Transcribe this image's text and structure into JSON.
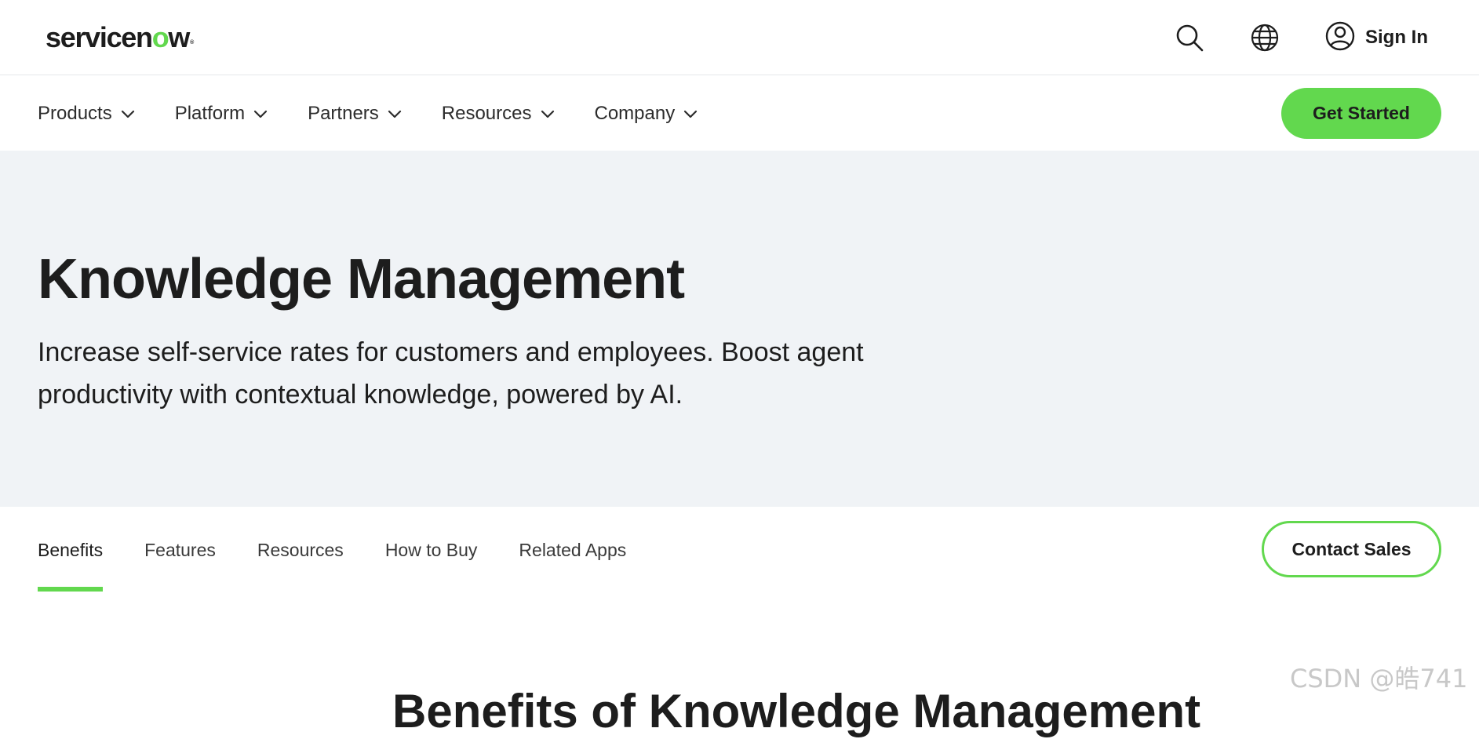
{
  "header": {
    "logo_text_before": "servicen",
    "logo_text_o": "o",
    "logo_text_after": "w",
    "logo_reg": "®",
    "icons": [
      "search-icon",
      "globe-icon",
      "user-circle-icon"
    ],
    "signin_label": "Sign In"
  },
  "nav": {
    "items": [
      {
        "label": "Products"
      },
      {
        "label": "Platform"
      },
      {
        "label": "Partners"
      },
      {
        "label": "Resources"
      },
      {
        "label": "Company"
      }
    ],
    "cta_label": "Get Started"
  },
  "hero": {
    "title": "Knowledge Management",
    "subtitle": "Increase self-service rates for customers and employees. Boost agent productivity with contextual knowledge, powered by AI."
  },
  "subnav": {
    "tabs": [
      {
        "label": "Benefits",
        "active": true
      },
      {
        "label": "Features",
        "active": false
      },
      {
        "label": "Resources",
        "active": false
      },
      {
        "label": "How to Buy",
        "active": false
      },
      {
        "label": "Related Apps",
        "active": false
      }
    ],
    "cta_label": "Contact Sales"
  },
  "section": {
    "heading": "Benefits of Knowledge Management"
  },
  "watermark": "CSDN @皓741",
  "colors": {
    "accent": "#62d84e",
    "hero_bg": "#f0f3f6",
    "text": "#1d1d1d"
  }
}
